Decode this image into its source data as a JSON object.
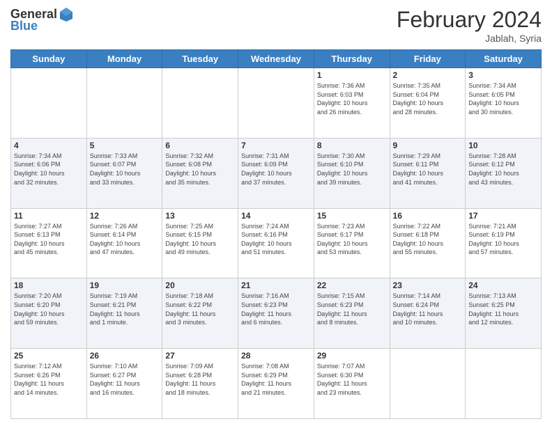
{
  "header": {
    "logo_general": "General",
    "logo_blue": "Blue",
    "title": "February 2024",
    "location": "Jablah, Syria"
  },
  "days_of_week": [
    "Sunday",
    "Monday",
    "Tuesday",
    "Wednesday",
    "Thursday",
    "Friday",
    "Saturday"
  ],
  "weeks": [
    {
      "shade": "white",
      "days": [
        {
          "num": "",
          "info": ""
        },
        {
          "num": "",
          "info": ""
        },
        {
          "num": "",
          "info": ""
        },
        {
          "num": "",
          "info": ""
        },
        {
          "num": "1",
          "info": "Sunrise: 7:36 AM\nSunset: 6:03 PM\nDaylight: 10 hours\nand 26 minutes."
        },
        {
          "num": "2",
          "info": "Sunrise: 7:35 AM\nSunset: 6:04 PM\nDaylight: 10 hours\nand 28 minutes."
        },
        {
          "num": "3",
          "info": "Sunrise: 7:34 AM\nSunset: 6:05 PM\nDaylight: 10 hours\nand 30 minutes."
        }
      ]
    },
    {
      "shade": "shade",
      "days": [
        {
          "num": "4",
          "info": "Sunrise: 7:34 AM\nSunset: 6:06 PM\nDaylight: 10 hours\nand 32 minutes."
        },
        {
          "num": "5",
          "info": "Sunrise: 7:33 AM\nSunset: 6:07 PM\nDaylight: 10 hours\nand 33 minutes."
        },
        {
          "num": "6",
          "info": "Sunrise: 7:32 AM\nSunset: 6:08 PM\nDaylight: 10 hours\nand 35 minutes."
        },
        {
          "num": "7",
          "info": "Sunrise: 7:31 AM\nSunset: 6:09 PM\nDaylight: 10 hours\nand 37 minutes."
        },
        {
          "num": "8",
          "info": "Sunrise: 7:30 AM\nSunset: 6:10 PM\nDaylight: 10 hours\nand 39 minutes."
        },
        {
          "num": "9",
          "info": "Sunrise: 7:29 AM\nSunset: 6:11 PM\nDaylight: 10 hours\nand 41 minutes."
        },
        {
          "num": "10",
          "info": "Sunrise: 7:28 AM\nSunset: 6:12 PM\nDaylight: 10 hours\nand 43 minutes."
        }
      ]
    },
    {
      "shade": "white",
      "days": [
        {
          "num": "11",
          "info": "Sunrise: 7:27 AM\nSunset: 6:13 PM\nDaylight: 10 hours\nand 45 minutes."
        },
        {
          "num": "12",
          "info": "Sunrise: 7:26 AM\nSunset: 6:14 PM\nDaylight: 10 hours\nand 47 minutes."
        },
        {
          "num": "13",
          "info": "Sunrise: 7:25 AM\nSunset: 6:15 PM\nDaylight: 10 hours\nand 49 minutes."
        },
        {
          "num": "14",
          "info": "Sunrise: 7:24 AM\nSunset: 6:16 PM\nDaylight: 10 hours\nand 51 minutes."
        },
        {
          "num": "15",
          "info": "Sunrise: 7:23 AM\nSunset: 6:17 PM\nDaylight: 10 hours\nand 53 minutes."
        },
        {
          "num": "16",
          "info": "Sunrise: 7:22 AM\nSunset: 6:18 PM\nDaylight: 10 hours\nand 55 minutes."
        },
        {
          "num": "17",
          "info": "Sunrise: 7:21 AM\nSunset: 6:19 PM\nDaylight: 10 hours\nand 57 minutes."
        }
      ]
    },
    {
      "shade": "shade",
      "days": [
        {
          "num": "18",
          "info": "Sunrise: 7:20 AM\nSunset: 6:20 PM\nDaylight: 10 hours\nand 59 minutes."
        },
        {
          "num": "19",
          "info": "Sunrise: 7:19 AM\nSunset: 6:21 PM\nDaylight: 11 hours\nand 1 minute."
        },
        {
          "num": "20",
          "info": "Sunrise: 7:18 AM\nSunset: 6:22 PM\nDaylight: 11 hours\nand 3 minutes."
        },
        {
          "num": "21",
          "info": "Sunrise: 7:16 AM\nSunset: 6:23 PM\nDaylight: 11 hours\nand 6 minutes."
        },
        {
          "num": "22",
          "info": "Sunrise: 7:15 AM\nSunset: 6:23 PM\nDaylight: 11 hours\nand 8 minutes."
        },
        {
          "num": "23",
          "info": "Sunrise: 7:14 AM\nSunset: 6:24 PM\nDaylight: 11 hours\nand 10 minutes."
        },
        {
          "num": "24",
          "info": "Sunrise: 7:13 AM\nSunset: 6:25 PM\nDaylight: 11 hours\nand 12 minutes."
        }
      ]
    },
    {
      "shade": "white",
      "days": [
        {
          "num": "25",
          "info": "Sunrise: 7:12 AM\nSunset: 6:26 PM\nDaylight: 11 hours\nand 14 minutes."
        },
        {
          "num": "26",
          "info": "Sunrise: 7:10 AM\nSunset: 6:27 PM\nDaylight: 11 hours\nand 16 minutes."
        },
        {
          "num": "27",
          "info": "Sunrise: 7:09 AM\nSunset: 6:28 PM\nDaylight: 11 hours\nand 18 minutes."
        },
        {
          "num": "28",
          "info": "Sunrise: 7:08 AM\nSunset: 6:29 PM\nDaylight: 11 hours\nand 21 minutes."
        },
        {
          "num": "29",
          "info": "Sunrise: 7:07 AM\nSunset: 6:30 PM\nDaylight: 11 hours\nand 23 minutes."
        },
        {
          "num": "",
          "info": ""
        },
        {
          "num": "",
          "info": ""
        }
      ]
    }
  ]
}
